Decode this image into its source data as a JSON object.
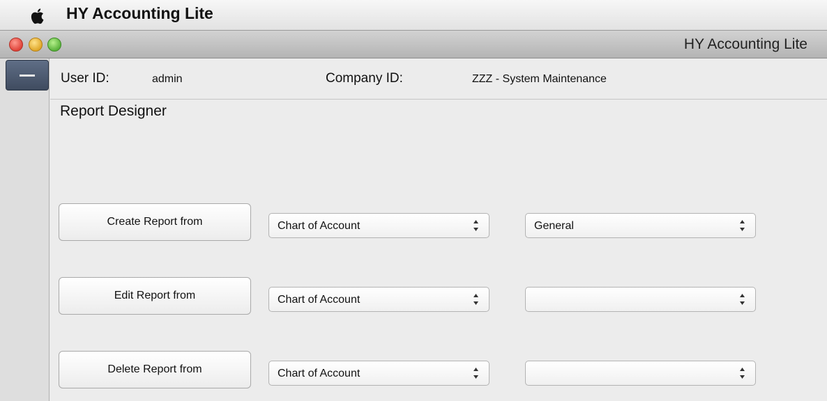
{
  "menubar": {
    "app_name": "HY Accounting Lite",
    "apple_icon": "apple-icon"
  },
  "window": {
    "title": "HY Accounting Lite"
  },
  "header": {
    "user_id_label": "User ID:",
    "user_id_value": "admin",
    "company_id_label": "Company ID:",
    "company_id_value": "ZZZ - System Maintenance"
  },
  "page": {
    "title": "Report Designer"
  },
  "rows": [
    {
      "button": "Create Report from",
      "source": "Chart of Account",
      "type": "General"
    },
    {
      "button": "Edit Report from",
      "source": "Chart of Account",
      "type": ""
    },
    {
      "button": "Delete Report from",
      "source": "Chart of Account",
      "type": ""
    }
  ],
  "colors": {
    "side_button": "#4b5870",
    "background": "#ececec"
  }
}
